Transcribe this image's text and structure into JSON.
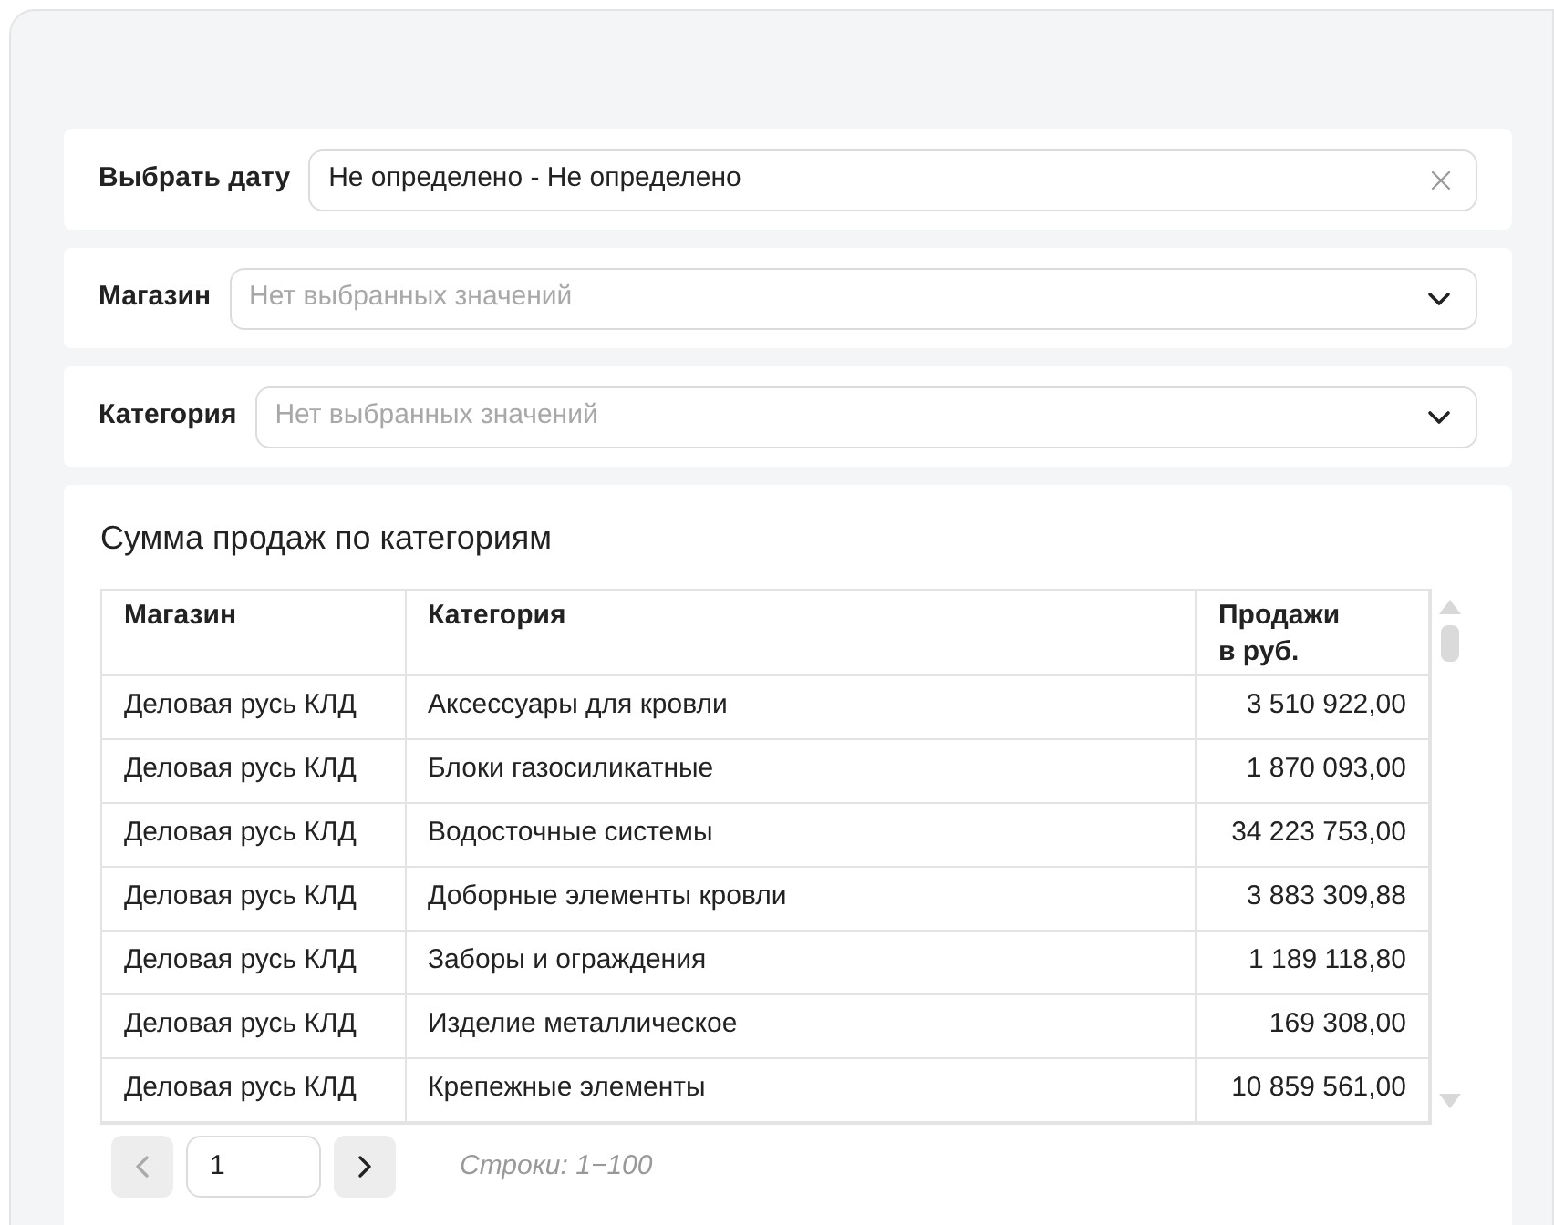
{
  "filters": [
    {
      "kind": "date",
      "label": "Выбрать дату",
      "value": "Не определено - Не определено"
    },
    {
      "kind": "select",
      "label": "Магазин",
      "placeholder": "Нет выбранных значений"
    },
    {
      "kind": "select",
      "label": "Категория",
      "placeholder": "Нет выбранных значений"
    }
  ],
  "report": {
    "title": "Сумма продаж по категориям",
    "table": {
      "columns": [
        "Магазин",
        "Категория",
        "Продажи\nв руб."
      ],
      "rows": [
        [
          "Деловая русь КЛД",
          "Аксессуары для кровли",
          "3 510 922,00"
        ],
        [
          "Деловая русь КЛД",
          "Блоки газосиликатные",
          "1 870 093,00"
        ],
        [
          "Деловая русь КЛД",
          "Водосточные системы",
          "34 223 753,00"
        ],
        [
          "Деловая русь КЛД",
          "Доборные элементы кровли",
          "3 883 309,88"
        ],
        [
          "Деловая русь КЛД",
          "Заборы и ограждения",
          "1 189 118,80"
        ],
        [
          "Деловая русь КЛД",
          "Изделие металлическое",
          "169 308,00"
        ],
        [
          "Деловая русь КЛД",
          "Крепежные элементы",
          "10 859 561,00"
        ]
      ]
    },
    "pagination": {
      "prev_disabled": true,
      "next_disabled": false,
      "page": "1",
      "rows_info": "Строки: 1−100"
    }
  }
}
